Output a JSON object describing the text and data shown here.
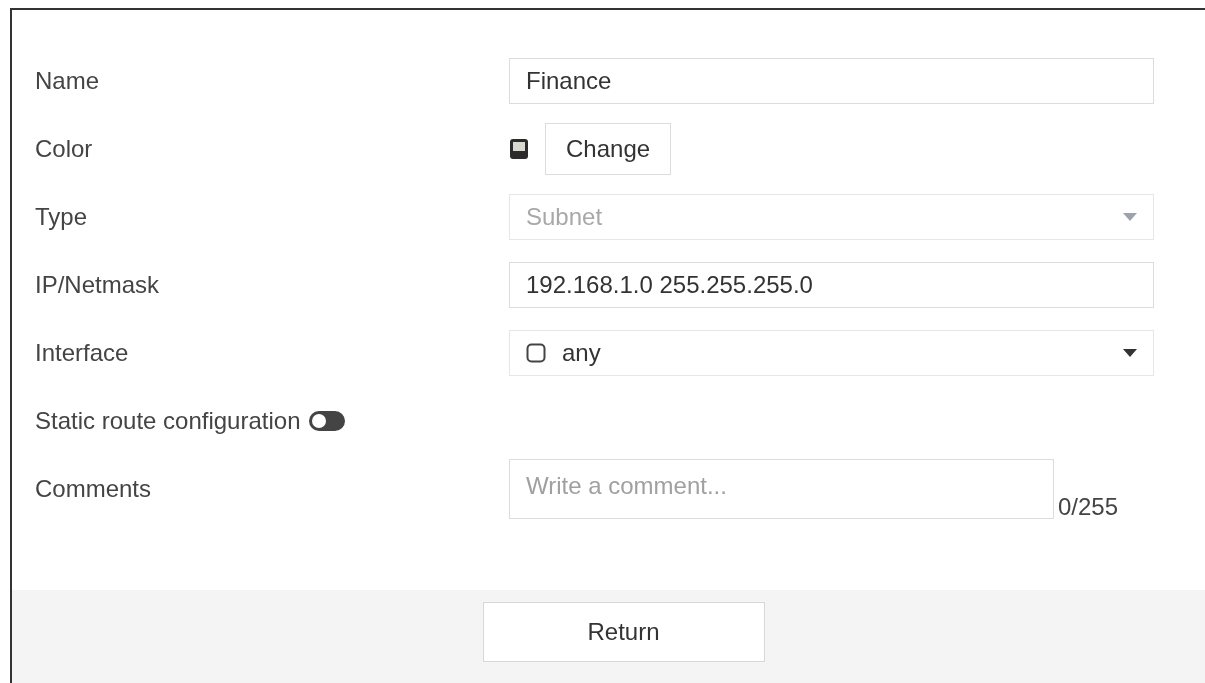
{
  "fields": [
    {
      "kind": "text",
      "label": "Name",
      "value": "Finance"
    },
    {
      "kind": "color",
      "label": "Color",
      "button": "Change"
    },
    {
      "kind": "select",
      "label": "Type",
      "value": "Subnet",
      "disabled": true
    },
    {
      "kind": "text",
      "label": "IP/Netmask",
      "value": "192.168.1.0 255.255.255.0"
    },
    {
      "kind": "interface",
      "label": "Interface",
      "value": "any",
      "disabled": false
    },
    {
      "kind": "toggle",
      "label": "Static route configuration",
      "on": false
    },
    {
      "kind": "textarea",
      "label": "Comments",
      "placeholder": "Write a comment...",
      "counter": "0/255"
    }
  ],
  "footer": {
    "button": "Return"
  }
}
